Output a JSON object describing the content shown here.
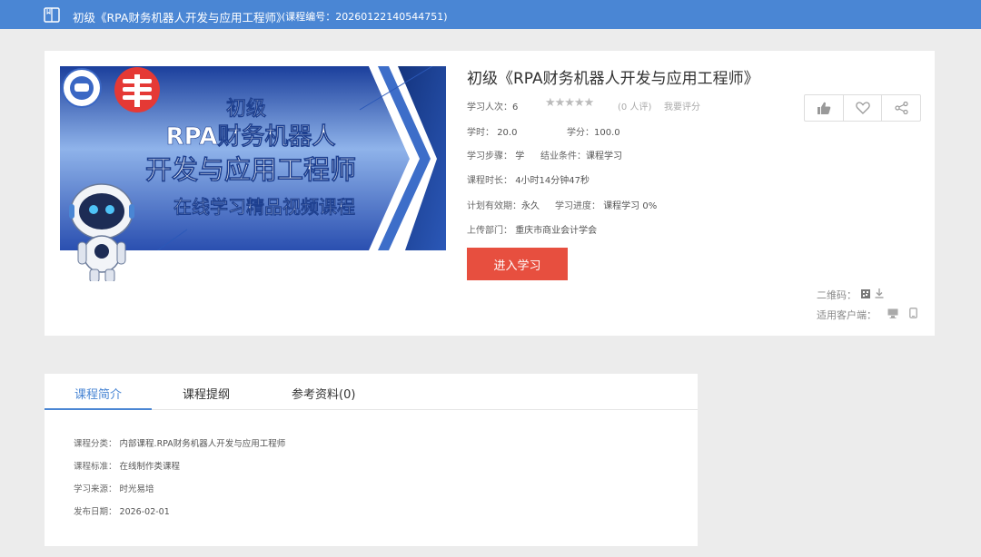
{
  "header": {
    "title": "初级《RPA财务机器人开发与应用工程师》",
    "code": "(课程编号：20260122140544751)"
  },
  "course": {
    "title": "初级《RPA财务机器人开发与应用工程师》",
    "learners_label": "学习人次：",
    "learners": "6",
    "stars": "★★★★★",
    "reviews": "(0 人评)",
    "rate_link": "我要评分",
    "hours_label": "学时：",
    "hours": "20.0",
    "credits_label": "学分：",
    "credits": "100.0",
    "steps_label": "学习步骤：",
    "steps": "学",
    "completion_label": "结业条件：",
    "completion": "课程学习",
    "duration_label": "课程时长：",
    "duration": "4小时14分钟47秒",
    "validity_label": "计划有效期：",
    "validity": "永久",
    "progress_label": "学习进度：",
    "progress": "课程学习  0%",
    "dept_label": "上传部门：",
    "dept": "重庆市商业会计学会",
    "enter_button": "进入学习",
    "qr_label": "二维码：",
    "client_label": "适用客户端：",
    "cover": {
      "line1": "初级",
      "line2": "RPA财务机器人",
      "line3": "开发与应用工程师",
      "line4": "在线学习精品视频课程"
    }
  },
  "tabs": [
    {
      "label": "课程简介",
      "active": true
    },
    {
      "label": "课程提纲",
      "active": false
    },
    {
      "label": "参考资料(0)",
      "active": false
    }
  ],
  "intro": {
    "category_label": "课程分类：",
    "category": "内部课程.RPA财务机器人开发与应用工程师",
    "standard_label": "课程标准：",
    "standard": "在线制作类课程",
    "source_label": "学习来源：",
    "source": "时光易培",
    "date_label": "发布日期：",
    "date": "2026-02-01"
  },
  "colors": {
    "topbar": "#4a86d4",
    "accent": "#4a86d4",
    "button": "#e74f3f"
  },
  "icons": [
    "book-icon",
    "thumbs-up-icon",
    "heart-icon",
    "share-icon",
    "qr-code-icon",
    "download-icon",
    "desktop-icon",
    "mobile-icon"
  ]
}
